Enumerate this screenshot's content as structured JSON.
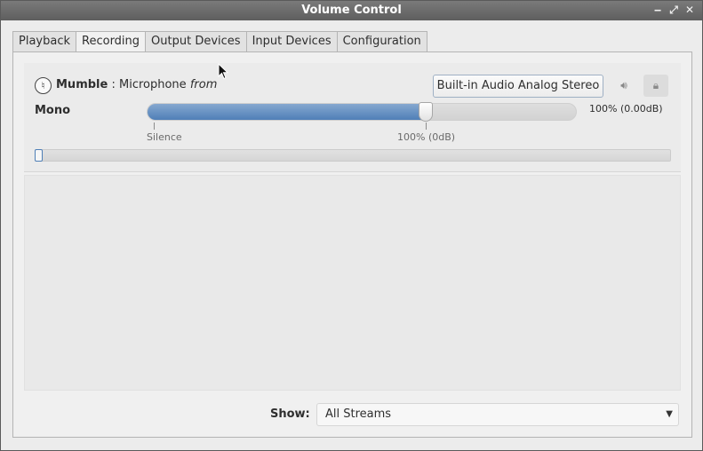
{
  "window": {
    "title": "Volume Control",
    "controls": {
      "minimize": "‒",
      "maximize": "⤢",
      "close": "✕"
    }
  },
  "tabs": [
    {
      "label": "Playback",
      "active": false
    },
    {
      "label": "Recording",
      "active": true
    },
    {
      "label": "Output Devices",
      "active": false
    },
    {
      "label": "Input Devices",
      "active": false
    },
    {
      "label": "Configuration",
      "active": false
    }
  ],
  "stream": {
    "app_icon": "mumble-icon",
    "app_name": "Mumble",
    "separator": ":",
    "name": "Microphone",
    "from_word": "from",
    "device_button": "Built-in Audio Analog Stereo",
    "mute_icon": "speaker-icon",
    "lock_icon": "lock-icon",
    "channel_label": "Mono",
    "volume_readout": "100% (0.00dB)",
    "volume_fraction": 0.65,
    "tick_silence": "Silence",
    "tick_base": "100% (0dB)",
    "peak_level": 0.0
  },
  "footer": {
    "show_label": "Show:",
    "show_value": "All Streams"
  },
  "colors": {
    "accent": "#4f7fb7",
    "titlebar": "#6b6b6b",
    "window_bg": "#ececec"
  }
}
